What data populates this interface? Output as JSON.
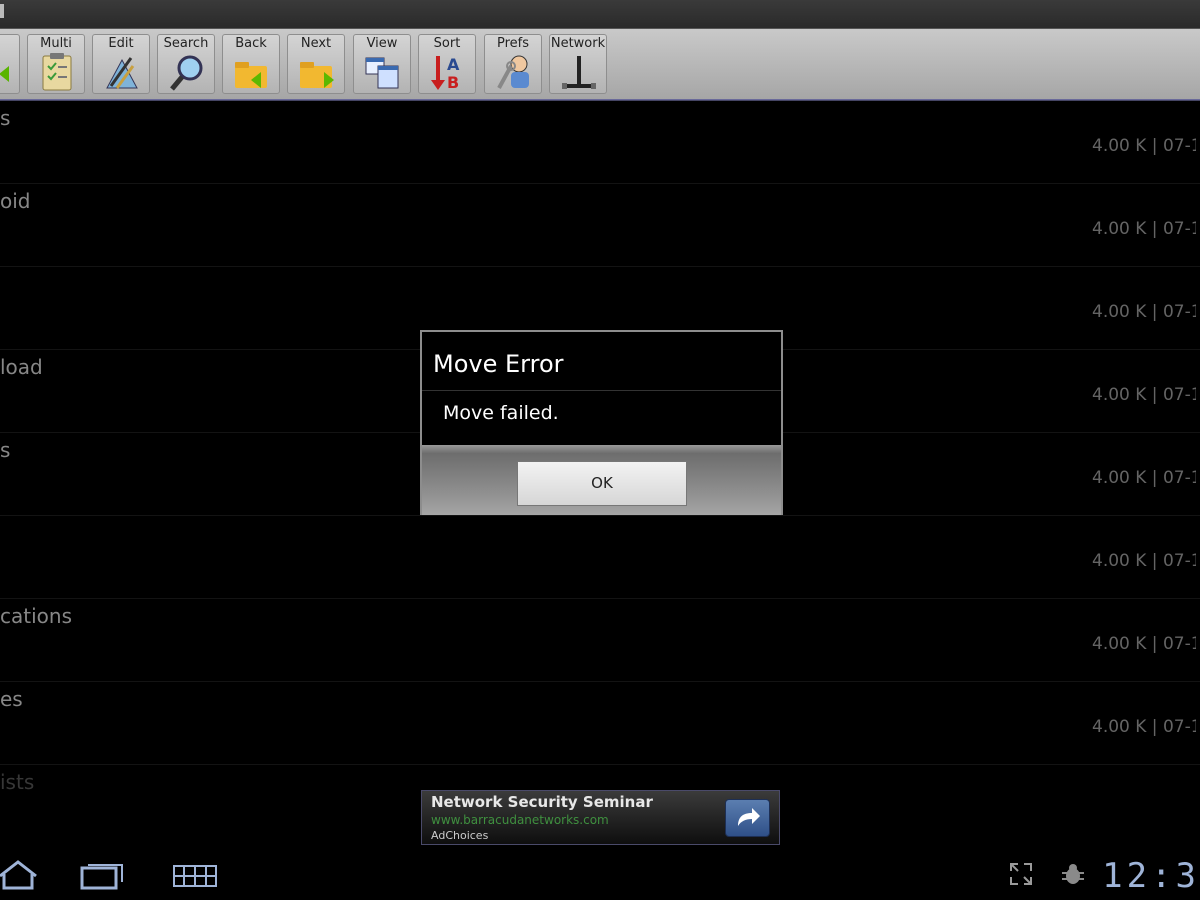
{
  "toolbar": {
    "buttons": [
      {
        "label": "Multi",
        "icon": "clipboard-check-icon"
      },
      {
        "label": "Edit",
        "icon": "edit-tools-icon"
      },
      {
        "label": "Search",
        "icon": "magnifier-icon"
      },
      {
        "label": "Back",
        "icon": "folder-back-icon"
      },
      {
        "label": "Next",
        "icon": "folder-next-icon"
      },
      {
        "label": "View",
        "icon": "view-windows-icon"
      },
      {
        "label": "Sort",
        "icon": "sort-ab-icon"
      },
      {
        "label": "Prefs",
        "icon": "prefs-wrench-icon"
      },
      {
        "label": "Network",
        "icon": "network-icon"
      }
    ]
  },
  "files": [
    {
      "name": "s",
      "meta": "4.00 K | 07-1"
    },
    {
      "name": "oid",
      "meta": "4.00 K | 07-1"
    },
    {
      "name": "",
      "meta": "4.00 K | 07-1"
    },
    {
      "name": "load",
      "meta": "4.00 K | 07-1"
    },
    {
      "name": "s",
      "meta": "4.00 K | 07-1"
    },
    {
      "name": "",
      "meta": "4.00 K | 07-1"
    },
    {
      "name": "cations",
      "meta": "4.00 K | 07-1"
    },
    {
      "name": "es",
      "meta": "4.00 K | 07-1"
    }
  ],
  "partial_row": "ists",
  "dialog": {
    "title": "Move Error",
    "message": "Move failed.",
    "ok_label": "OK"
  },
  "ad": {
    "title": "Network Security Seminar",
    "url": "www.barracudanetworks.com",
    "choices": "AdChoices"
  },
  "status": {
    "clock": "12:3"
  },
  "colors": {
    "toolbar_bg": "#b8b8b8",
    "dialog_bg": "#000000",
    "accent_blue": "#9fb4d8",
    "ad_url": "#3f8f3f"
  }
}
